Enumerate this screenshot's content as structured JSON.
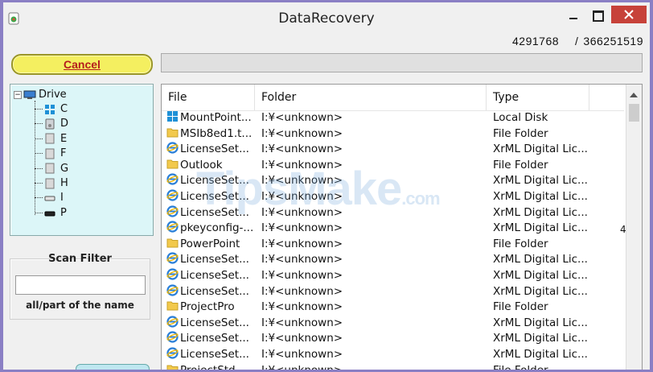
{
  "window": {
    "title": "DataRecovery",
    "counter_current": "4291768",
    "counter_separator": "/",
    "counter_total": "366251519"
  },
  "toolbar": {
    "cancel_label": "Cancel",
    "progress_percent": 0
  },
  "tree": {
    "root_label": "Drive",
    "root_expander": "−",
    "drives": [
      "C",
      "D",
      "E",
      "F",
      "G",
      "H",
      "I",
      "P"
    ]
  },
  "scan_filter": {
    "title": "Scan Filter",
    "value": "",
    "hint": "all/part of the name"
  },
  "file_list": {
    "columns": {
      "file": "File",
      "folder": "Folder",
      "type": "Type"
    },
    "rows": [
      {
        "file": "MountPoint...",
        "folder": "I:¥<unknown>",
        "type": "Local Disk",
        "icon": "disk-icon"
      },
      {
        "file": "MSIb8ed1.t...",
        "folder": "I:¥<unknown>",
        "type": "File Folder",
        "icon": "folder-icon"
      },
      {
        "file": "LicenseSet...",
        "folder": "I:¥<unknown>",
        "type": "XrML Digital Lic...",
        "icon": "ie-icon"
      },
      {
        "file": "Outlook",
        "folder": "I:¥<unknown>",
        "type": "File Folder",
        "icon": "folder-icon"
      },
      {
        "file": "LicenseSet...",
        "folder": "I:¥<unknown>",
        "type": "XrML Digital Lic...",
        "icon": "ie-icon"
      },
      {
        "file": "LicenseSet...",
        "folder": "I:¥<unknown>",
        "type": "XrML Digital Lic...",
        "icon": "ie-icon"
      },
      {
        "file": "LicenseSet...",
        "folder": "I:¥<unknown>",
        "type": "XrML Digital Lic...",
        "icon": "ie-icon"
      },
      {
        "file": "pkeyconfig-...",
        "folder": "I:¥<unknown>",
        "type": "XrML Digital Lic...",
        "icon": "ie-icon"
      },
      {
        "file": "PowerPoint",
        "folder": "I:¥<unknown>",
        "type": "File Folder",
        "icon": "folder-icon"
      },
      {
        "file": "LicenseSet...",
        "folder": "I:¥<unknown>",
        "type": "XrML Digital Lic...",
        "icon": "ie-icon"
      },
      {
        "file": "LicenseSet...",
        "folder": "I:¥<unknown>",
        "type": "XrML Digital Lic...",
        "icon": "ie-icon"
      },
      {
        "file": "LicenseSet...",
        "folder": "I:¥<unknown>",
        "type": "XrML Digital Lic...",
        "icon": "ie-icon"
      },
      {
        "file": "ProjectPro",
        "folder": "I:¥<unknown>",
        "type": "File Folder",
        "icon": "folder-icon"
      },
      {
        "file": "LicenseSet...",
        "folder": "I:¥<unknown>",
        "type": "XrML Digital Lic...",
        "icon": "ie-icon"
      },
      {
        "file": "LicenseSet...",
        "folder": "I:¥<unknown>",
        "type": "XrML Digital Lic...",
        "icon": "ie-icon"
      },
      {
        "file": "LicenseSet...",
        "folder": "I:¥<unknown>",
        "type": "XrML Digital Lic...",
        "icon": "ie-icon"
      },
      {
        "file": "ProjectStd",
        "folder": "I:¥<unknown>",
        "type": "File Folder",
        "icon": "folder-icon"
      }
    ],
    "extra_text": "4"
  },
  "watermark": {
    "text": "TipsMake",
    "suffix": ".com"
  },
  "colors": {
    "titlebar": "#f0f0f0",
    "close_button": "#c7423a",
    "cancel_button": "#f4ef60",
    "cancel_text": "#b41d1d",
    "tree_background": "#dcf6f8",
    "outer_frame": "#8a7fc4"
  }
}
